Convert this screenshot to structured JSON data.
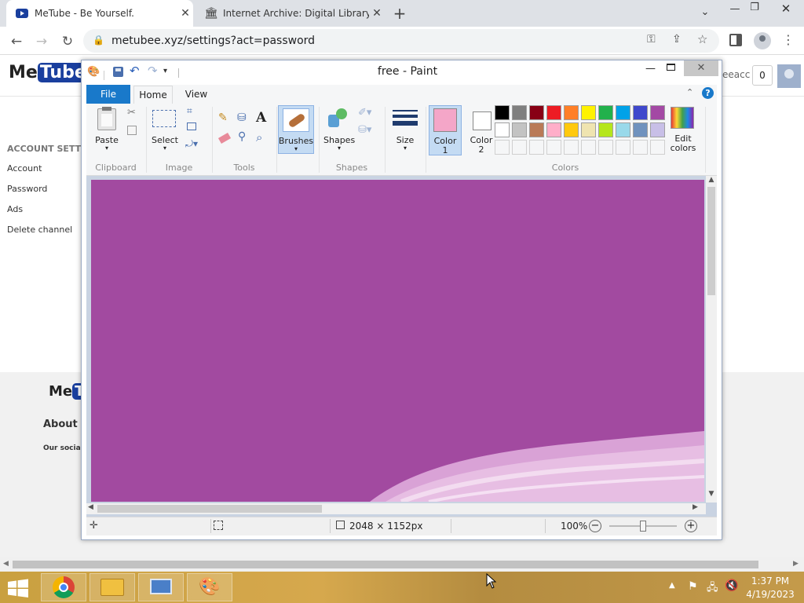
{
  "browser": {
    "tabs": [
      {
        "title": "MeTube - Be Yourself.",
        "close": "✕"
      },
      {
        "title": "Internet Archive: Digital Library o",
        "close": "✕"
      }
    ],
    "new_tab": "+",
    "url": "metubee.xyz/settings?act=password"
  },
  "metube": {
    "logo_me": "Me",
    "logo_tube": "Tube",
    "user_partial": "eeacc",
    "notif_count": "0",
    "section_title": "ACCOUNT SETTI",
    "menu": [
      "Account",
      "Password",
      "Ads",
      "Delete channel"
    ],
    "footer_logo_me": "Me",
    "footer_logo_tube": "Tu",
    "footer_about": "About",
    "footer_social": "Our socia"
  },
  "paint": {
    "title": "free - Paint",
    "tabs": {
      "file": "File",
      "home": "Home",
      "view": "View"
    },
    "groups": {
      "clipboard": "Clipboard",
      "image": "Image",
      "tools": "Tools",
      "shapes": "Shapes",
      "colors": "Colors"
    },
    "buttons": {
      "paste": "Paste",
      "select": "Select",
      "brushes": "Brushes",
      "shapes": "Shapes",
      "size": "Size",
      "color1": "Color",
      "color1_num": "1",
      "color2": "Color",
      "color2_num": "2",
      "edit": "Edit",
      "colors": "colors"
    },
    "color1_value": "#f4a6c8",
    "color2_value": "#ffffff",
    "canvas_color": "#a24aa0",
    "palette_row1": [
      "#000000",
      "#7f7f7f",
      "#880015",
      "#ed1c24",
      "#ff7f27",
      "#fff200",
      "#22b14c",
      "#00a2e8",
      "#3f48cc",
      "#a349a4"
    ],
    "palette_row2": [
      "#ffffff",
      "#c3c3c3",
      "#b97a57",
      "#ffaec9",
      "#ffc90e",
      "#efe4b0",
      "#b5e61d",
      "#99d9ea",
      "#7092be",
      "#c8bfe7"
    ],
    "status": {
      "dimensions": "2048 × 1152px",
      "zoom": "100%"
    }
  },
  "taskbar": {
    "time": "1:37 PM",
    "date": "4/19/2023"
  }
}
